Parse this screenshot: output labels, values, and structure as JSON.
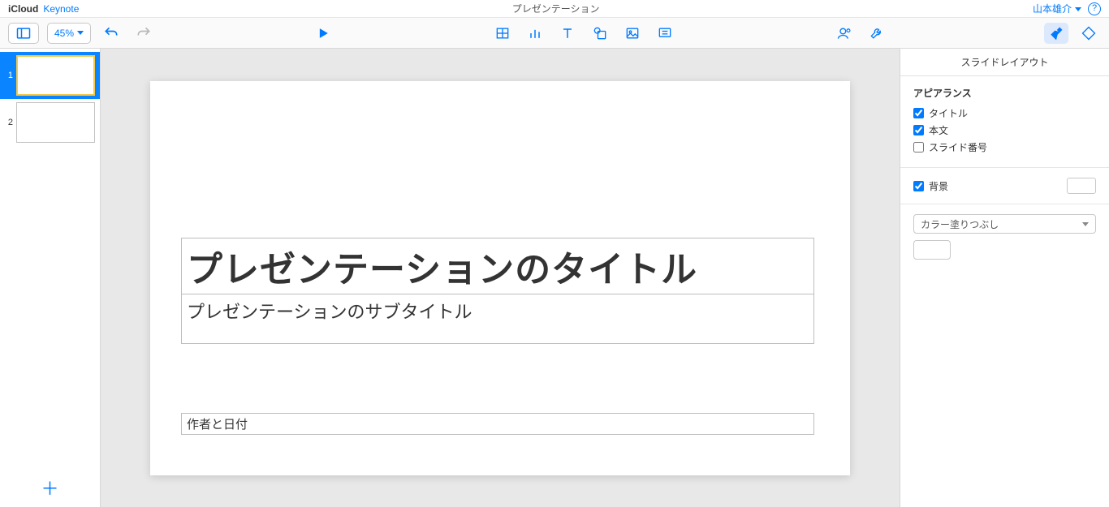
{
  "titlebar": {
    "brand": "iCloud",
    "app": "Keynote",
    "docname": "プレゼンテーション",
    "username": "山本雄介"
  },
  "toolbar": {
    "zoom": "45%"
  },
  "slides": [
    {
      "num": "1"
    },
    {
      "num": "2"
    }
  ],
  "slide": {
    "title": "プレゼンテーションのタイトル",
    "subtitle": "プレゼンテーションのサブタイトル",
    "author": "作者と日付"
  },
  "inspector": {
    "panel_title": "スライドレイアウト",
    "appearance_label": "アピアランス",
    "title_label": "タイトル",
    "body_label": "本文",
    "slidenum_label": "スライド番号",
    "background_label": "背景",
    "fill_select": "カラー塗りつぶし"
  }
}
